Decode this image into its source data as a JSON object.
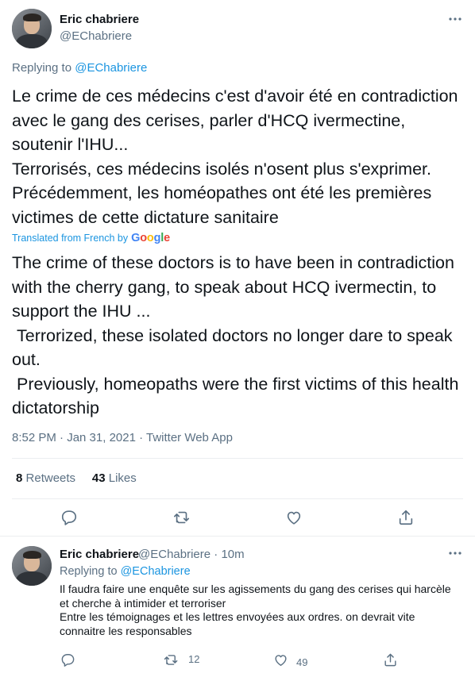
{
  "main_tweet": {
    "author_name": "Eric chabriere",
    "author_handle": "@EChabriere",
    "replying_label": "Replying to",
    "replying_to": "@EChabriere",
    "text_fr": "Le crime de ces médecins c'est d'avoir été en contradiction avec le gang des cerises, parler d'HCQ ivermectine, soutenir l'IHU...\nTerrorisés, ces médecins isolés n'osent plus s'exprimer.\nPrécédemment, les homéopathes ont été les premières victimes de cette dictature sanitaire",
    "translated_label": "Translated from French by",
    "translator": "Google",
    "text_en": "The crime of these doctors is to have been in contradiction with the cherry gang, to speak about HCQ ivermectin, to support the IHU ...\n Terrorized, these isolated doctors no longer dare to speak out.\n Previously, homeopaths were the first victims of this health dictatorship",
    "timestamp": "8:52 PM · Jan 31, 2021 · Twitter Web App",
    "retweets_count": "8",
    "retweets_label": "Retweets",
    "likes_count": "43",
    "likes_label": "Likes",
    "icons": [
      "reply-icon",
      "retweet-icon",
      "like-icon",
      "share-icon",
      "more-icon"
    ]
  },
  "reply_tweet": {
    "author_name": "Eric chabriere",
    "author_handle": "@EChabriere",
    "separator": "·",
    "time_ago": "10m",
    "replying_label": "Replying to",
    "replying_to": "@EChabriere",
    "text": "Il faudra faire une enquête sur les agissements du gang des cerises  qui harcèle et cherche à  intimider et terroriser\nEntre les témoignages et les lettres envoyées aux ordres. on devrait vite connaitre les responsables",
    "reply_count": "",
    "retweet_count": "12",
    "like_count": "49"
  },
  "colors": {
    "accent": "#1b95e0",
    "muted": "#5b7083",
    "text": "#0f1419",
    "divider": "#ebeef0"
  }
}
